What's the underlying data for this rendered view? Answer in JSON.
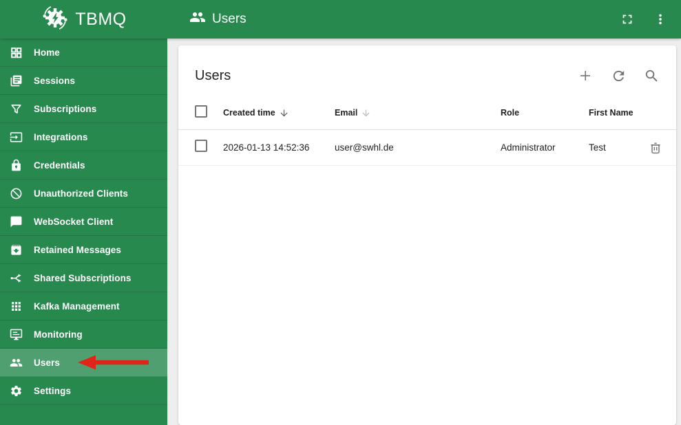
{
  "colors": {
    "primary_green": "#28894f",
    "active_item_overlay": "rgba(255,255,255,0.19)",
    "page_bg": "#eeeeee",
    "icon_gray": "#757575",
    "annotation_red": "#e02418"
  },
  "topbar": {
    "logo_text": "TBMQ",
    "page_title": "Users"
  },
  "sidebar": {
    "items": [
      {
        "label": "Home",
        "icon": "dashboard-icon",
        "active": false
      },
      {
        "label": "Sessions",
        "icon": "book-icon",
        "active": false
      },
      {
        "label": "Subscriptions",
        "icon": "filter-icon",
        "active": false
      },
      {
        "label": "Integrations",
        "icon": "input-icon",
        "active": false
      },
      {
        "label": "Credentials",
        "icon": "lock-icon",
        "active": false
      },
      {
        "label": "Unauthorized Clients",
        "icon": "block-icon",
        "active": false
      },
      {
        "label": "WebSocket Client",
        "icon": "chat-icon",
        "active": false
      },
      {
        "label": "Retained Messages",
        "icon": "archive-icon",
        "active": false
      },
      {
        "label": "Shared Subscriptions",
        "icon": "split-icon",
        "active": false
      },
      {
        "label": "Kafka Management",
        "icon": "apps-grid-icon",
        "active": false
      },
      {
        "label": "Monitoring",
        "icon": "monitor-icon",
        "active": false
      },
      {
        "label": "Users",
        "icon": "people-icon",
        "active": true
      },
      {
        "label": "Settings",
        "icon": "gear-icon",
        "active": false
      }
    ]
  },
  "card": {
    "title": "Users",
    "toolbar": {
      "add_label": "add",
      "refresh_label": "refresh",
      "search_label": "search"
    }
  },
  "table": {
    "columns": [
      {
        "label": "Created time",
        "sort": "active-desc"
      },
      {
        "label": "Email",
        "sort": "inactive-desc"
      },
      {
        "label": "Role",
        "sort": "none"
      },
      {
        "label": "First Name",
        "sort": "none"
      }
    ],
    "rows": [
      {
        "created_time": "2026-01-13 14:52:36",
        "email": "user@swhl.de",
        "role": "Administrator",
        "first_name": "Test"
      }
    ]
  }
}
